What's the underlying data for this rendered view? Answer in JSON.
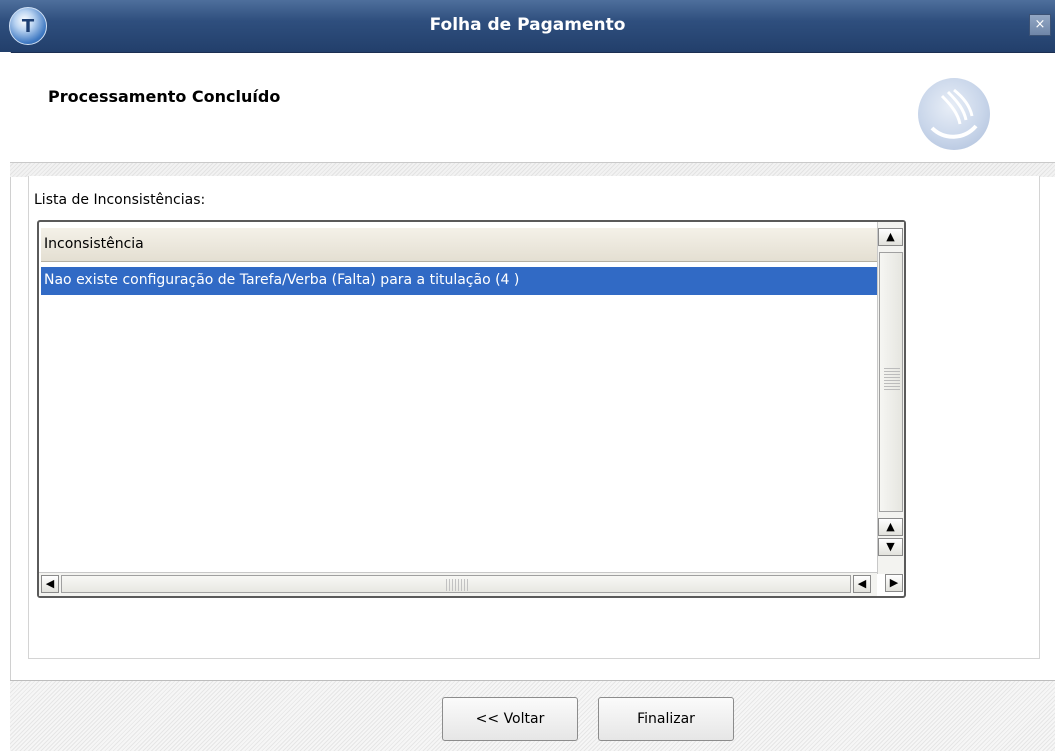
{
  "window": {
    "title": "Folha de Pagamento",
    "close_label": "×"
  },
  "header": {
    "title": "Processamento Concluído"
  },
  "list": {
    "caption": "Lista de Inconsistências:",
    "column_header": "Inconsistência",
    "rows": [
      "Nao existe configuração de Tarefa/Verba (Falta) para a titulação (4 )"
    ],
    "selected_row": 0
  },
  "footer": {
    "back_label": "<< Voltar",
    "finish_label": "Finalizar"
  },
  "colors": {
    "title_bar": "#2f4f7e",
    "selection": "#316ac5"
  },
  "icons": {
    "app": "app-logo-icon",
    "brand": "brand-logo-icon",
    "close": "close-icon"
  }
}
